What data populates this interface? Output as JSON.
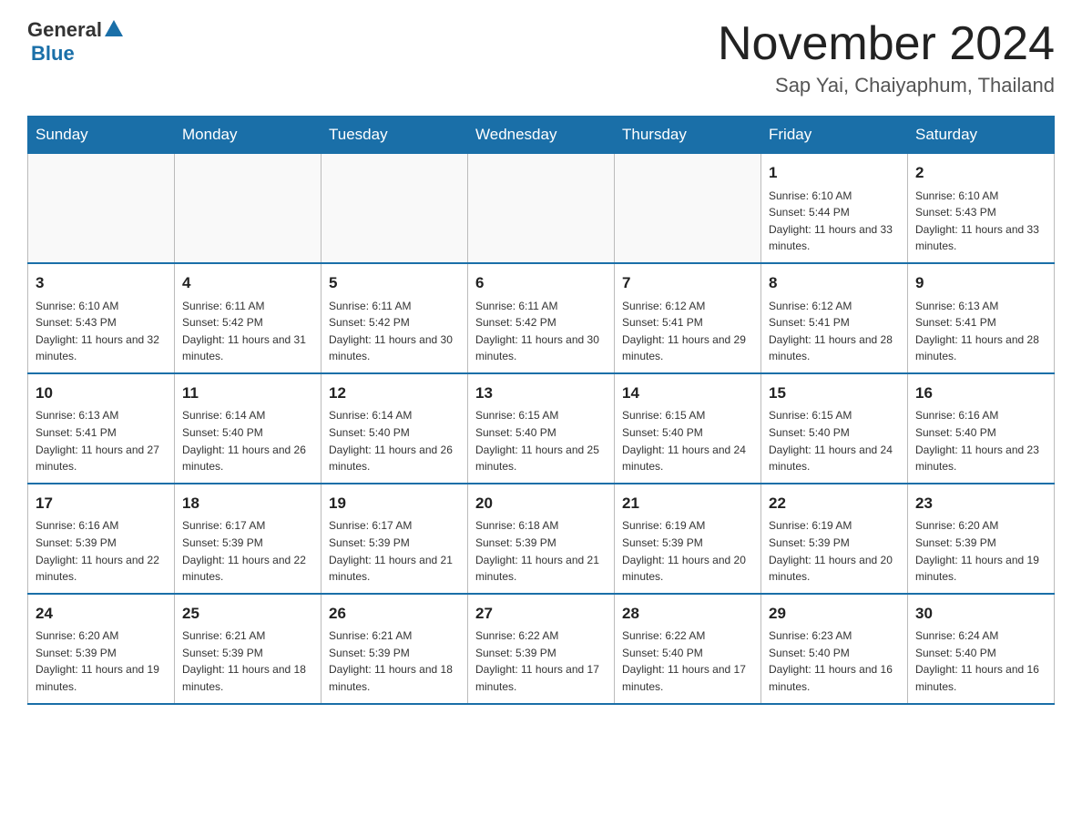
{
  "header": {
    "logo_general": "General",
    "logo_blue": "Blue",
    "month_title": "November 2024",
    "subtitle": "Sap Yai, Chaiyaphum, Thailand"
  },
  "weekdays": [
    "Sunday",
    "Monday",
    "Tuesday",
    "Wednesday",
    "Thursday",
    "Friday",
    "Saturday"
  ],
  "weeks": [
    [
      {
        "day": "",
        "info": ""
      },
      {
        "day": "",
        "info": ""
      },
      {
        "day": "",
        "info": ""
      },
      {
        "day": "",
        "info": ""
      },
      {
        "day": "",
        "info": ""
      },
      {
        "day": "1",
        "info": "Sunrise: 6:10 AM\nSunset: 5:44 PM\nDaylight: 11 hours and 33 minutes."
      },
      {
        "day": "2",
        "info": "Sunrise: 6:10 AM\nSunset: 5:43 PM\nDaylight: 11 hours and 33 minutes."
      }
    ],
    [
      {
        "day": "3",
        "info": "Sunrise: 6:10 AM\nSunset: 5:43 PM\nDaylight: 11 hours and 32 minutes."
      },
      {
        "day": "4",
        "info": "Sunrise: 6:11 AM\nSunset: 5:42 PM\nDaylight: 11 hours and 31 minutes."
      },
      {
        "day": "5",
        "info": "Sunrise: 6:11 AM\nSunset: 5:42 PM\nDaylight: 11 hours and 30 minutes."
      },
      {
        "day": "6",
        "info": "Sunrise: 6:11 AM\nSunset: 5:42 PM\nDaylight: 11 hours and 30 minutes."
      },
      {
        "day": "7",
        "info": "Sunrise: 6:12 AM\nSunset: 5:41 PM\nDaylight: 11 hours and 29 minutes."
      },
      {
        "day": "8",
        "info": "Sunrise: 6:12 AM\nSunset: 5:41 PM\nDaylight: 11 hours and 28 minutes."
      },
      {
        "day": "9",
        "info": "Sunrise: 6:13 AM\nSunset: 5:41 PM\nDaylight: 11 hours and 28 minutes."
      }
    ],
    [
      {
        "day": "10",
        "info": "Sunrise: 6:13 AM\nSunset: 5:41 PM\nDaylight: 11 hours and 27 minutes."
      },
      {
        "day": "11",
        "info": "Sunrise: 6:14 AM\nSunset: 5:40 PM\nDaylight: 11 hours and 26 minutes."
      },
      {
        "day": "12",
        "info": "Sunrise: 6:14 AM\nSunset: 5:40 PM\nDaylight: 11 hours and 26 minutes."
      },
      {
        "day": "13",
        "info": "Sunrise: 6:15 AM\nSunset: 5:40 PM\nDaylight: 11 hours and 25 minutes."
      },
      {
        "day": "14",
        "info": "Sunrise: 6:15 AM\nSunset: 5:40 PM\nDaylight: 11 hours and 24 minutes."
      },
      {
        "day": "15",
        "info": "Sunrise: 6:15 AM\nSunset: 5:40 PM\nDaylight: 11 hours and 24 minutes."
      },
      {
        "day": "16",
        "info": "Sunrise: 6:16 AM\nSunset: 5:40 PM\nDaylight: 11 hours and 23 minutes."
      }
    ],
    [
      {
        "day": "17",
        "info": "Sunrise: 6:16 AM\nSunset: 5:39 PM\nDaylight: 11 hours and 22 minutes."
      },
      {
        "day": "18",
        "info": "Sunrise: 6:17 AM\nSunset: 5:39 PM\nDaylight: 11 hours and 22 minutes."
      },
      {
        "day": "19",
        "info": "Sunrise: 6:17 AM\nSunset: 5:39 PM\nDaylight: 11 hours and 21 minutes."
      },
      {
        "day": "20",
        "info": "Sunrise: 6:18 AM\nSunset: 5:39 PM\nDaylight: 11 hours and 21 minutes."
      },
      {
        "day": "21",
        "info": "Sunrise: 6:19 AM\nSunset: 5:39 PM\nDaylight: 11 hours and 20 minutes."
      },
      {
        "day": "22",
        "info": "Sunrise: 6:19 AM\nSunset: 5:39 PM\nDaylight: 11 hours and 20 minutes."
      },
      {
        "day": "23",
        "info": "Sunrise: 6:20 AM\nSunset: 5:39 PM\nDaylight: 11 hours and 19 minutes."
      }
    ],
    [
      {
        "day": "24",
        "info": "Sunrise: 6:20 AM\nSunset: 5:39 PM\nDaylight: 11 hours and 19 minutes."
      },
      {
        "day": "25",
        "info": "Sunrise: 6:21 AM\nSunset: 5:39 PM\nDaylight: 11 hours and 18 minutes."
      },
      {
        "day": "26",
        "info": "Sunrise: 6:21 AM\nSunset: 5:39 PM\nDaylight: 11 hours and 18 minutes."
      },
      {
        "day": "27",
        "info": "Sunrise: 6:22 AM\nSunset: 5:39 PM\nDaylight: 11 hours and 17 minutes."
      },
      {
        "day": "28",
        "info": "Sunrise: 6:22 AM\nSunset: 5:40 PM\nDaylight: 11 hours and 17 minutes."
      },
      {
        "day": "29",
        "info": "Sunrise: 6:23 AM\nSunset: 5:40 PM\nDaylight: 11 hours and 16 minutes."
      },
      {
        "day": "30",
        "info": "Sunrise: 6:24 AM\nSunset: 5:40 PM\nDaylight: 11 hours and 16 minutes."
      }
    ]
  ]
}
